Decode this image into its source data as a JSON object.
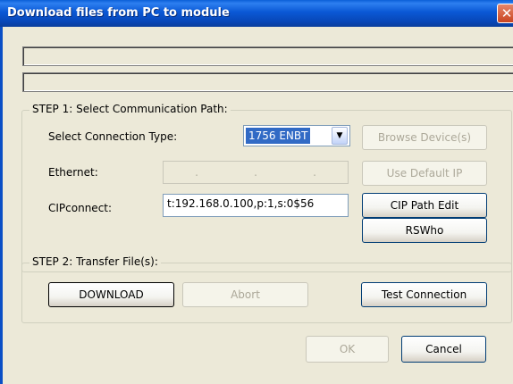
{
  "window": {
    "title": "Download files from PC to module",
    "close_glyph": "✕"
  },
  "status": {
    "line1": "",
    "line2": ""
  },
  "step1": {
    "label": "STEP 1: Select Communication Path:",
    "connection_type_label": "Select Connection Type:",
    "connection_type_value": "1756 ENBT",
    "ethernet_label": "Ethernet:",
    "ethernet_ip_dots": [
      ".",
      ".",
      "."
    ],
    "cipconnect_label": "CIPconnect:",
    "cipconnect_value": "t:192.168.0.100,p:1,s:0$56",
    "browse_button": "Browse Device(s)",
    "default_ip_button": "Use Default IP",
    "cip_path_button": "CIP Path Edit",
    "rswho_button": "RSWho"
  },
  "step2": {
    "label": "STEP 2: Transfer File(s):",
    "download_button": "DOWNLOAD",
    "abort_button": "Abort",
    "test_button": "Test Connection"
  },
  "footer": {
    "ok_button": "OK",
    "cancel_button": "Cancel"
  },
  "colors": {
    "titlebar": "#0a58d5",
    "dialog_bg": "#ece9d8",
    "close_button": "#c94420",
    "selected_combo": "#316ac5"
  }
}
